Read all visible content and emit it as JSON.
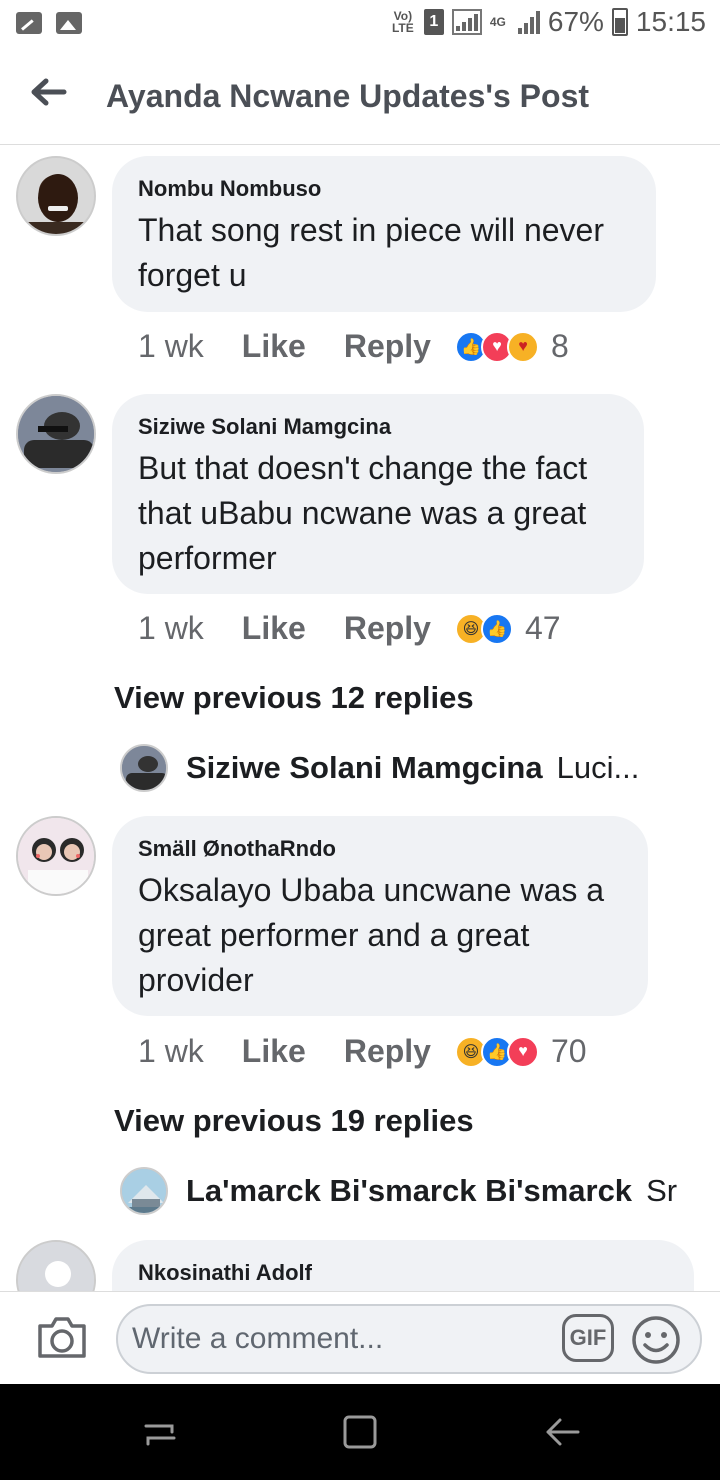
{
  "status_bar": {
    "volte": "Vo) LTE",
    "sim": "1",
    "network": "4G",
    "battery": "67%",
    "time": "15:15"
  },
  "header": {
    "back_icon": "arrow-left-icon",
    "title": "Ayanda Ncwane Updates's Post"
  },
  "comments": [
    {
      "author": "Nombu Nombuso",
      "text": "That song rest in piece will never forget u",
      "time": "1 wk",
      "like_label": "Like",
      "reply_label": "Reply",
      "reactions": [
        "like",
        "love",
        "care"
      ],
      "reaction_count": "8"
    },
    {
      "author": "Siziwe Solani Mamgcina",
      "text": "But that doesn't change the fact that uBabu ncwane was a great performer",
      "time": "1 wk",
      "like_label": "Like",
      "reply_label": "Reply",
      "reactions": [
        "haha",
        "like"
      ],
      "reaction_count": "47",
      "view_previous": "View previous 12 replies",
      "reply_preview": {
        "name": "Siziwe Solani Mamgcina",
        "snippet": "Luci..."
      }
    },
    {
      "author": "Smäll ØnothaRndo",
      "text": "Oksalayo Ubaba uncwane was a great performer and a great provider",
      "time": "1 wk",
      "like_label": "Like",
      "reply_label": "Reply",
      "reactions": [
        "haha",
        "like",
        "love"
      ],
      "reaction_count": "70",
      "view_previous": "View previous 19 replies",
      "reply_preview": {
        "name": "La'marck Bi'smarck Bi'smarck",
        "snippet": "Sr"
      }
    },
    {
      "author": "Nkosinathi Adolf"
    }
  ],
  "composer": {
    "placeholder": "Write a comment...",
    "gif_label": "GIF",
    "camera_icon": "camera-icon",
    "emoji_icon": "smiley-icon"
  },
  "navbar": {
    "recents_icon": "recent-apps-icon",
    "home_icon": "home-square-icon",
    "back_icon": "back-arrow-icon"
  }
}
